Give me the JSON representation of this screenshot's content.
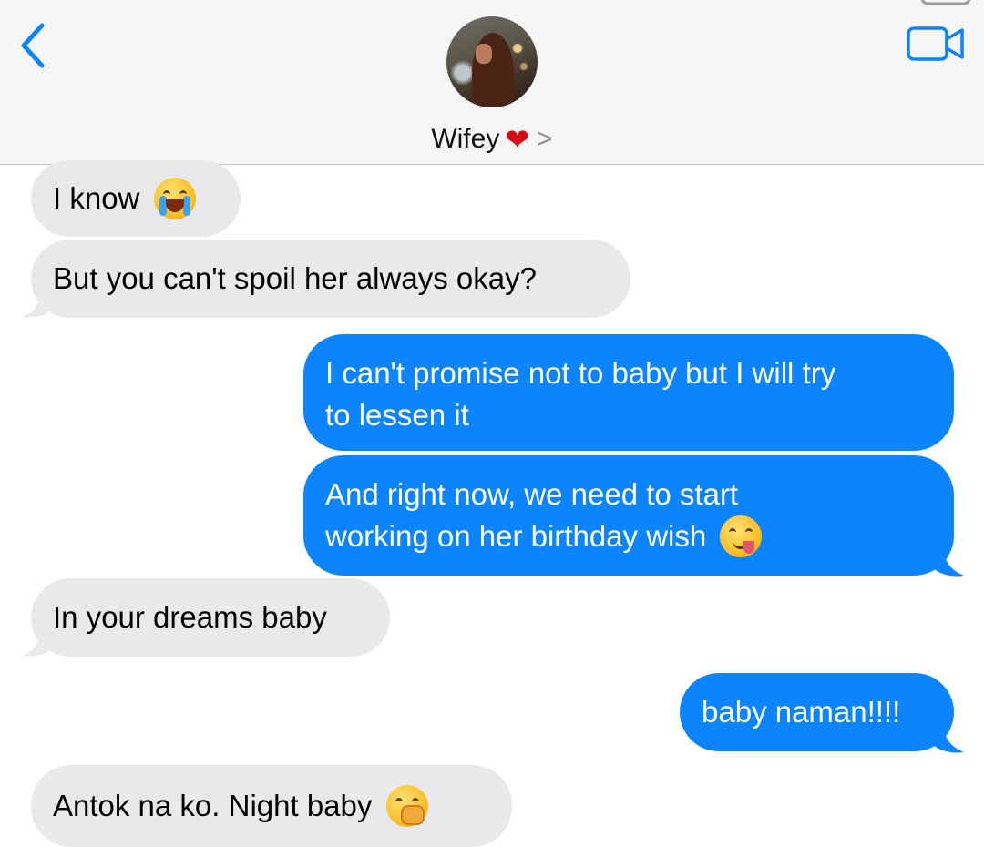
{
  "header": {
    "contact_name": "Wifey",
    "heart": "❤",
    "chevron": ">",
    "back_icon": "chevron-left-icon",
    "video_icon": "video-camera-icon",
    "accent_color": "#0b84fe"
  },
  "messages": [
    {
      "direction": "incoming",
      "text": "I know",
      "emoji": "loudly-crying-face"
    },
    {
      "direction": "incoming",
      "text": "But you can't spoil her always okay?"
    },
    {
      "direction": "outgoing",
      "line1": "I can't promise not to baby but I will try",
      "line2": "to lessen it"
    },
    {
      "direction": "outgoing",
      "line1": "And right now, we need to start",
      "line2": "working on her birthday wish",
      "emoji": "face-savoring-food"
    },
    {
      "direction": "incoming",
      "text": "In your dreams baby"
    },
    {
      "direction": "outgoing",
      "text": "baby naman!!!!"
    },
    {
      "direction": "incoming",
      "text": "Antok na ko. Night baby",
      "emoji": "yawning-face"
    }
  ],
  "colors": {
    "incoming_bubble": "#e9e9eb",
    "outgoing_bubble": "#0b84fe",
    "header_bg": "#f6f6f7"
  }
}
